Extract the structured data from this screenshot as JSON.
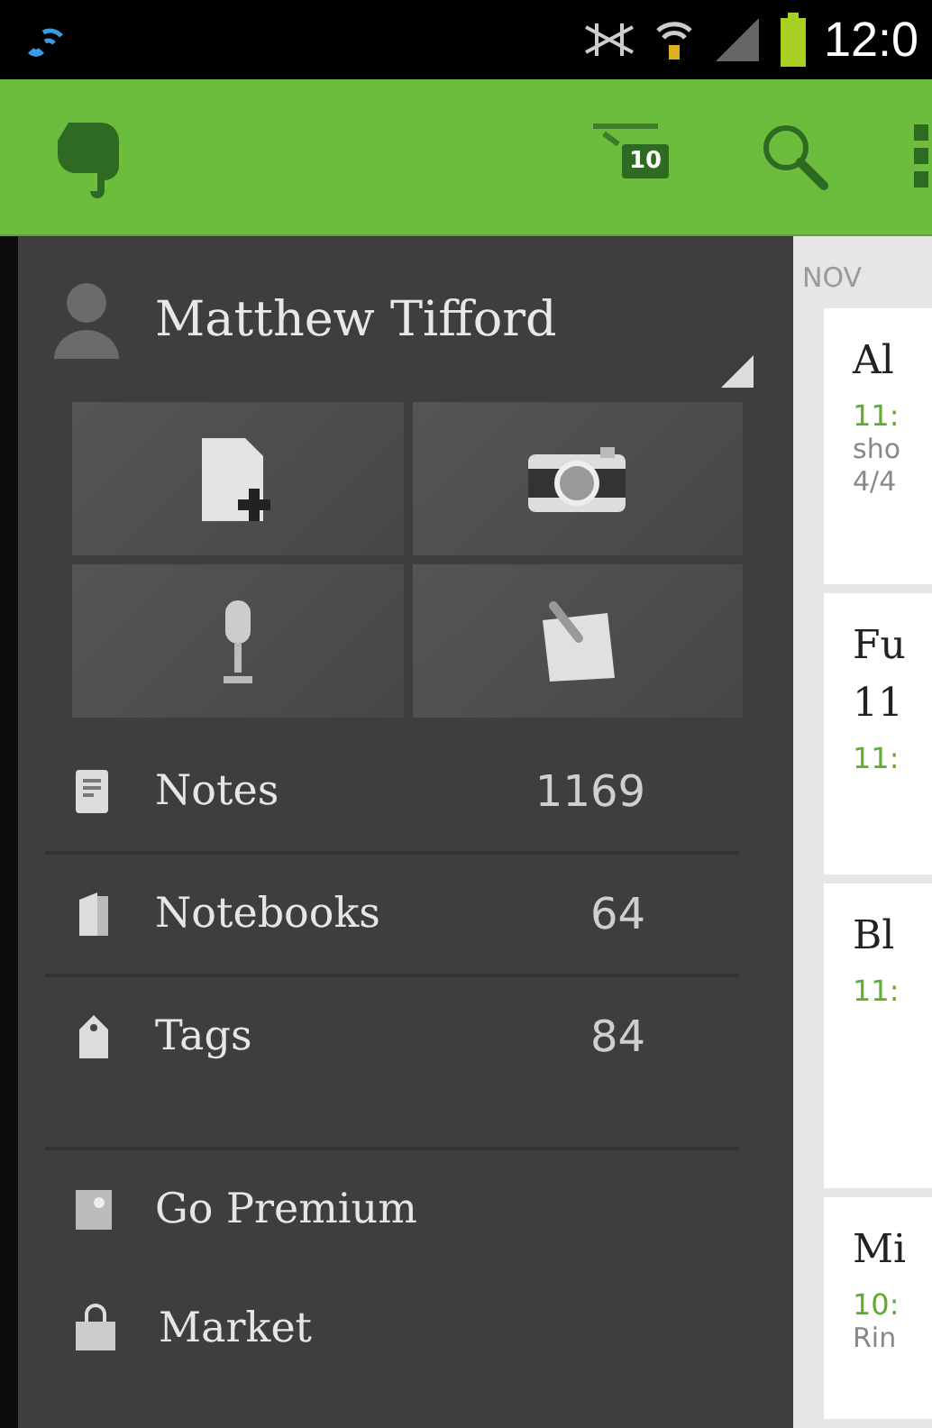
{
  "status_bar": {
    "time": "12:0"
  },
  "app_bar": {
    "sync_badge": "10"
  },
  "drawer": {
    "user": "Matthew Tifford",
    "quick_actions": [
      {
        "kind": "new-note"
      },
      {
        "kind": "camera"
      },
      {
        "kind": "audio"
      },
      {
        "kind": "attachment"
      }
    ],
    "nav": [
      {
        "kind": "notes",
        "label": "Notes",
        "count": "1169"
      },
      {
        "kind": "notebooks",
        "label": "Notebooks",
        "count": "64"
      },
      {
        "kind": "tags",
        "label": "Tags",
        "count": "84"
      }
    ],
    "extras": [
      {
        "kind": "premium",
        "label": "Go Premium"
      },
      {
        "kind": "market",
        "label": "Market"
      }
    ]
  },
  "notes": {
    "section": "NOV",
    "cards": [
      {
        "title_lines": [
          "Al"
        ],
        "time": "11:",
        "lines": [
          "sho",
          "4/4"
        ]
      },
      {
        "title_lines": [
          "Fu",
          "11"
        ],
        "time": "11:"
      },
      {
        "title_lines": [
          "Bl"
        ],
        "time": "11:"
      },
      {
        "title_lines": [
          "Mi"
        ],
        "time": "10:",
        "lines": [
          "Rin"
        ]
      }
    ]
  }
}
